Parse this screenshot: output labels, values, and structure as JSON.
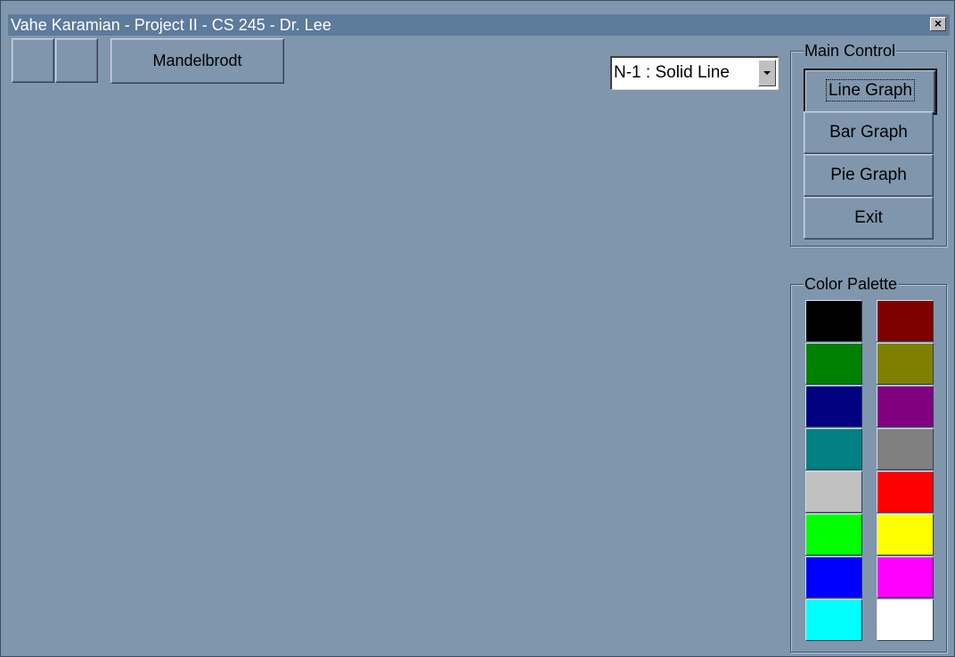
{
  "window": {
    "title": "Vahe Karamian - Project II - CS 245 - Dr. Lee",
    "close_symbol": "×"
  },
  "toolbar": {
    "mandelbrot_label": "Mandelbrodt"
  },
  "line_style": {
    "selected": "N-1 : Solid Line"
  },
  "main_control": {
    "title": "Main Control",
    "buttons": [
      {
        "label": "Line Graph"
      },
      {
        "label": "Bar Graph"
      },
      {
        "label": "Pie Graph"
      },
      {
        "label": "Exit"
      }
    ]
  },
  "color_palette": {
    "title": "Color Palette",
    "left_column": [
      "#000000",
      "#008000",
      "#000080",
      "#008080",
      "#c0c0c0",
      "#00ff00",
      "#0000ff",
      "#00ffff"
    ],
    "right_column": [
      "#800000",
      "#808000",
      "#800080",
      "#808080",
      "#ff0000",
      "#ffff00",
      "#ff00ff",
      "#ffffff"
    ]
  }
}
